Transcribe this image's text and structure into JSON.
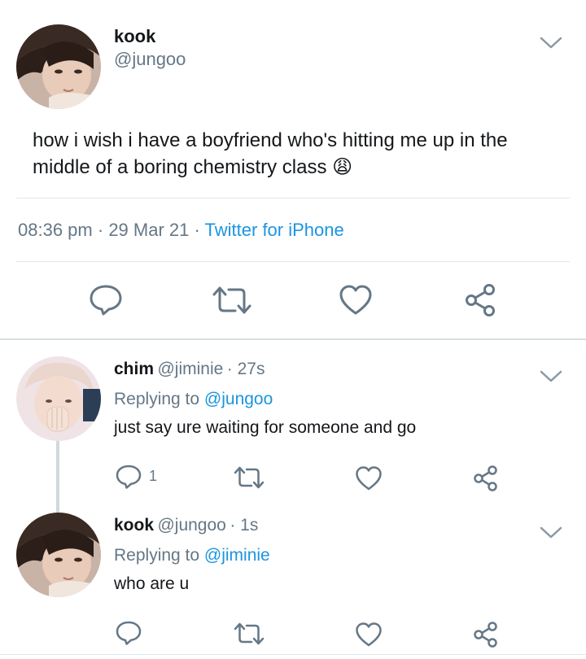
{
  "main_tweet": {
    "display_name": "kook",
    "handle": "@jungoo",
    "text_line1": "how i wish i have a boyfriend who's hitting me up in the",
    "text_line2": "middle of a boring chemistry class",
    "emoji": "😩",
    "time": "08:36 pm",
    "separator": "·",
    "date": "29 Mar 21",
    "source": "Twitter for iPhone"
  },
  "replies": [
    {
      "display_name": "chim",
      "handle": "@jiminie",
      "age": "· 27s",
      "replying_prefix": "Replying to",
      "replying_to": "@jungoo",
      "text": "just say ure waiting for someone and go",
      "reply_count": "1"
    },
    {
      "display_name": "kook",
      "handle": "@jungoo",
      "age": "· 1s",
      "replying_prefix": "Replying to",
      "replying_to": "@jiminie",
      "text": "who are u",
      "reply_count": ""
    }
  ],
  "colors": {
    "icon_gray": "#657786",
    "link_blue": "#1b95e0",
    "divider": "#e1e8ed",
    "thread_line": "#cfd9de"
  }
}
